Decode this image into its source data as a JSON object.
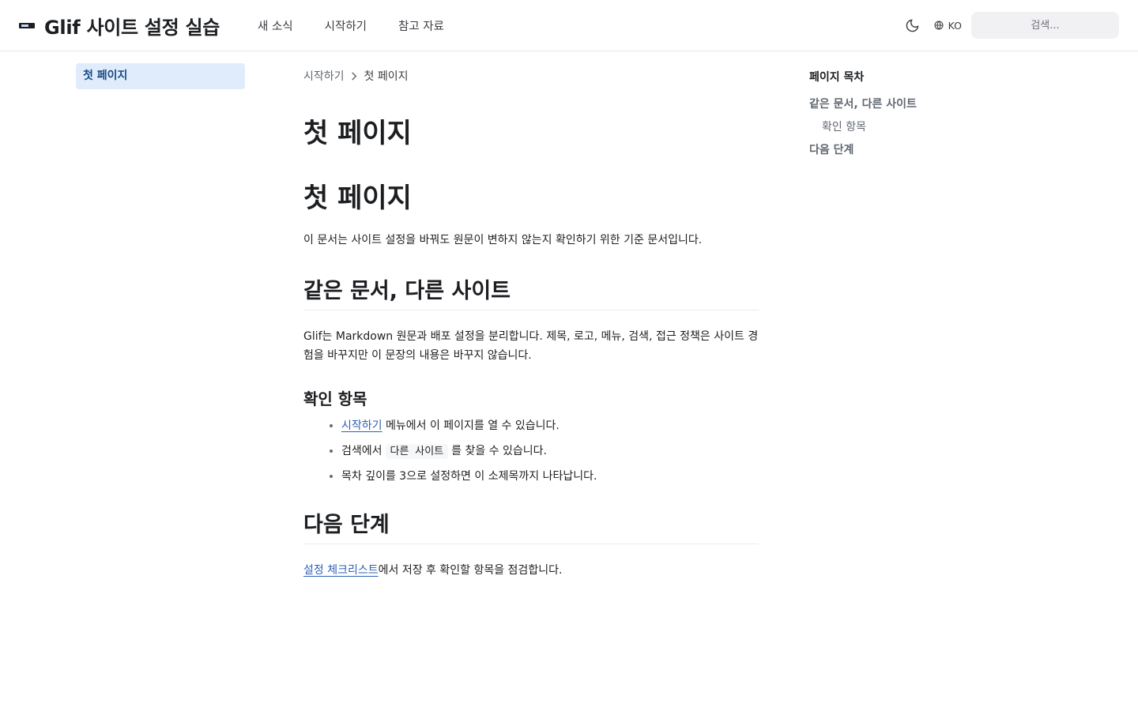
{
  "header": {
    "title": "Glif 사이트 설정 실습",
    "nav": [
      {
        "label": "새 소식"
      },
      {
        "label": "시작하기"
      },
      {
        "label": "참고 자료"
      }
    ],
    "language_label": "KO",
    "search_placeholder": "검색..."
  },
  "sidebar": {
    "items": [
      {
        "label": "첫 페이지",
        "active": true
      }
    ]
  },
  "breadcrumb": {
    "parent": "시작하기",
    "current": "첫 페이지"
  },
  "main": {
    "page_title": "첫 페이지",
    "doc_title": "첫 페이지",
    "intro": "이 문서는 사이트 설정을 바꿔도 원문이 변하지 않는지 확인하기 위한 기준 문서입니다.",
    "section1": {
      "heading": "같은 문서, 다른 사이트",
      "paragraph": "Glif는 Markdown 원문과 배포 설정을 분리합니다. 제목, 로고, 메뉴, 검색, 접근 정책은 사이트 경험을 바꾸지만 이 문장의 내용은 바꾸지 않습니다."
    },
    "subsection": {
      "heading": "확인 항목",
      "item1_link": "시작하기",
      "item1_text": " 메뉴에서 이 페이지를 열 수 있습니다.",
      "item2_before": "검색에서",
      "item2_code": "다른 사이트",
      "item2_after": "를 찾을 수 있습니다.",
      "item3_text": "목차 깊이를 3으로 설정하면 이 소제목까지 나타납니다."
    },
    "section2": {
      "heading": "다음 단계",
      "link": "설정 체크리스트",
      "text": "에서 저장 후 확인할 항목을 점검합니다."
    }
  },
  "toc": {
    "title": "페이지 목차",
    "items": [
      {
        "label": "같은 문서, 다른 사이트",
        "level": 2
      },
      {
        "label": "확인 항목",
        "level": 3
      },
      {
        "label": "다음 단계",
        "level": 2
      }
    ]
  },
  "colors": {
    "accent": "#2e5fb5",
    "sidebar_active_bg": "#e0ecfb",
    "sidebar_active_text": "#174a86"
  }
}
